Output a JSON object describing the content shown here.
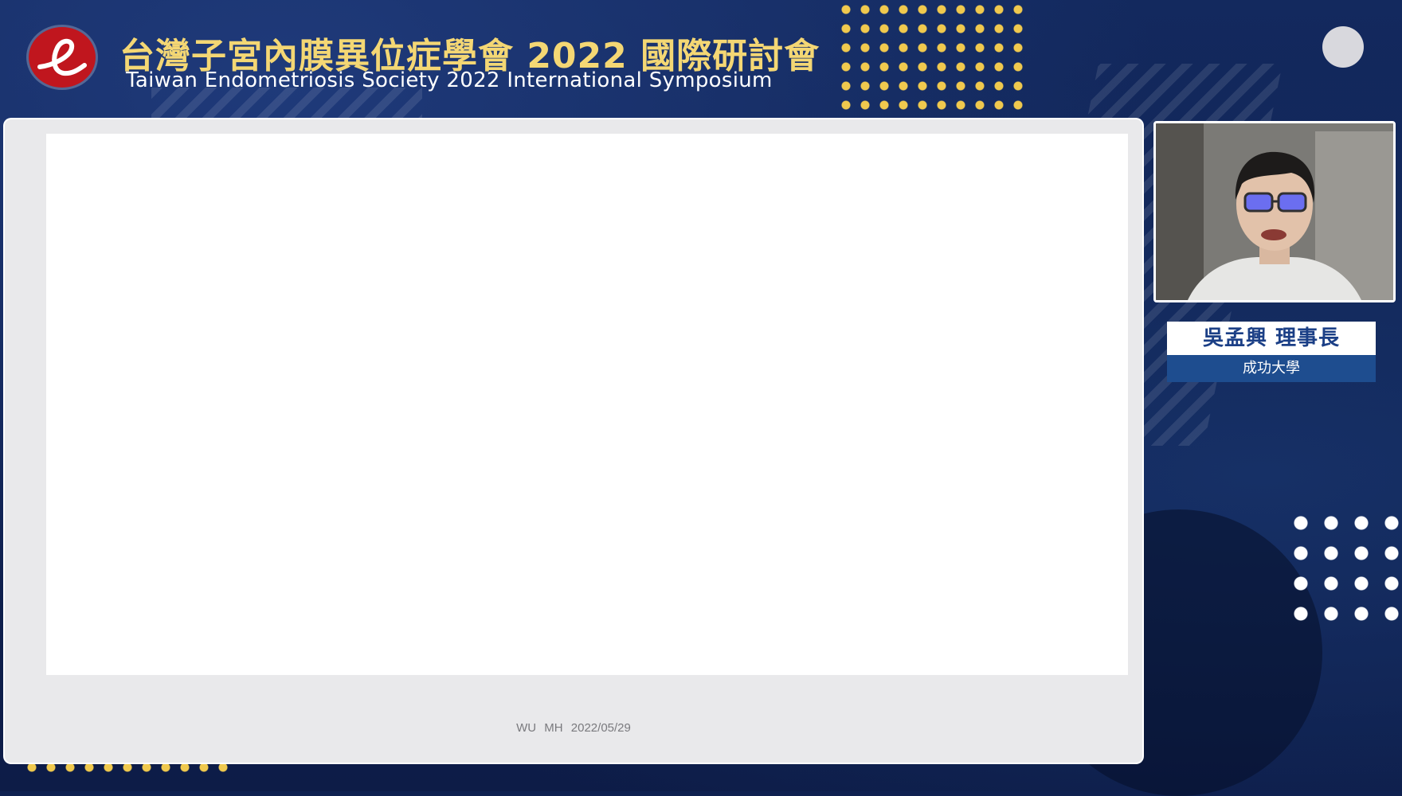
{
  "header": {
    "title_zh": "台灣子宮內膜異位症學會 2022 國際研討會",
    "title_en": "Taiwan Endometriosis Society 2022 International Symposium"
  },
  "slide": {
    "footer": "WU MH 2022/05/29"
  },
  "speaker": {
    "name": "吳孟興 理事長",
    "affiliation": "成功大學"
  },
  "icons": {
    "logo": "society-e-logo-icon",
    "user": "participant-avatar-icon"
  },
  "colors": {
    "background": "#0f2150",
    "title_gold": "#f4d774",
    "logo_red": "#c0161e",
    "name_blue": "#1b3f86",
    "affiliation_bar": "#1e4d8f"
  }
}
